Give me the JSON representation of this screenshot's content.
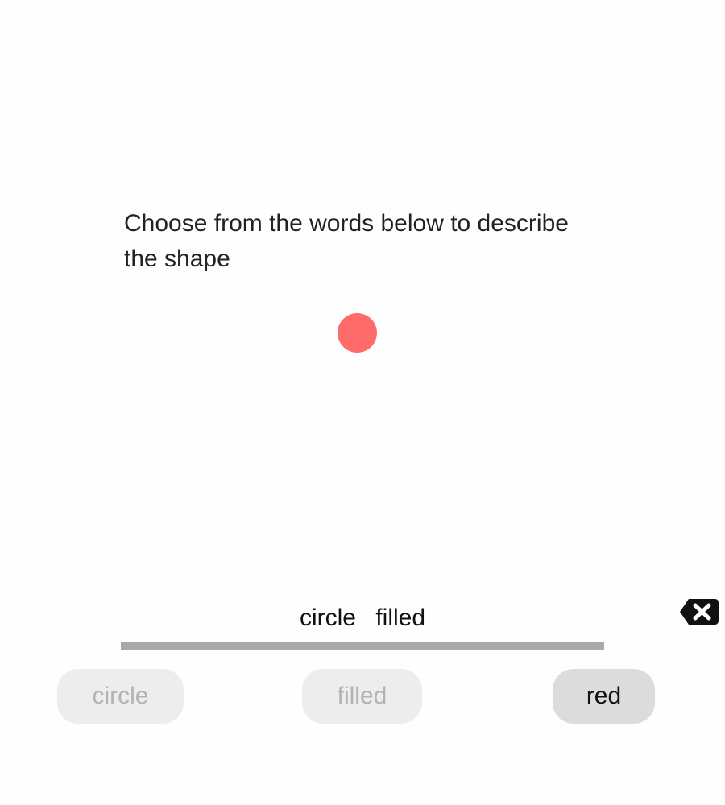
{
  "prompt": "Choose from the words below to describe the shape",
  "shape": {
    "type": "circle",
    "fill_color": "#ff6b6b",
    "filled": true
  },
  "answer": {
    "words": [
      "circle",
      "filled"
    ]
  },
  "delete_icon": "backspace-icon",
  "word_bank": [
    {
      "label": "circle",
      "state": "used"
    },
    {
      "label": "filled",
      "state": "used"
    },
    {
      "label": "red",
      "state": "available"
    }
  ],
  "colors": {
    "underline": "#a9a9a9",
    "chip_used_bg": "#ededed",
    "chip_used_text": "#b3b3b3",
    "chip_available_bg": "#dcdcdc",
    "icon": "#111111"
  }
}
